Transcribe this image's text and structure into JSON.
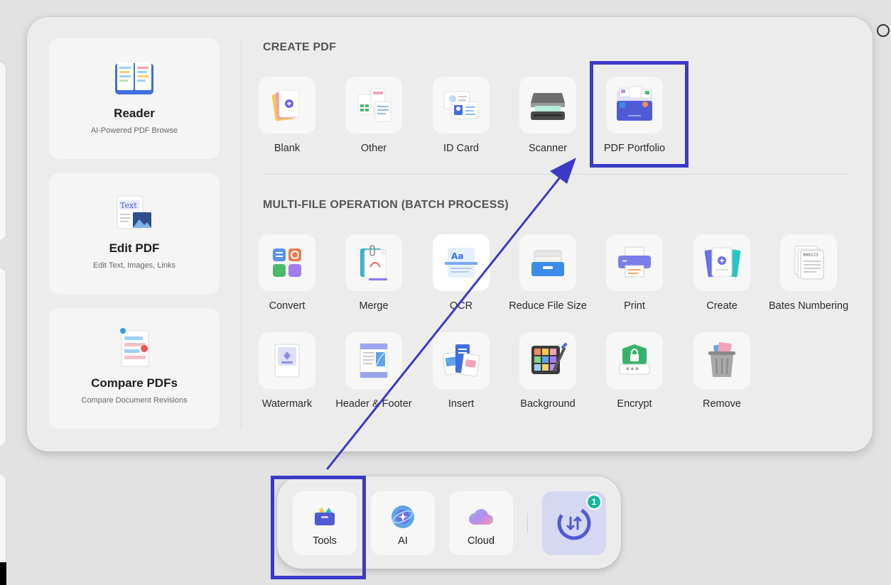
{
  "features": [
    {
      "title": "Reader",
      "subtitle": "AI-Powered PDF Browse",
      "icon": "book-icon"
    },
    {
      "title": "Edit PDF",
      "subtitle": "Edit Text, Images, Links",
      "icon": "edit-text-icon",
      "icon_text": "Text"
    },
    {
      "title": "Compare PDFs",
      "subtitle": "Compare Document Revisions",
      "icon": "compare-icon"
    }
  ],
  "create_section": {
    "title": "CREATE PDF",
    "tools": [
      {
        "label": "Blank",
        "icon": "blank-page-icon"
      },
      {
        "label": "Other",
        "icon": "other-files-icon"
      },
      {
        "label": "ID Card",
        "icon": "id-card-icon"
      },
      {
        "label": "Scanner",
        "icon": "scanner-icon"
      },
      {
        "label": "PDF Portfolio",
        "icon": "portfolio-icon"
      }
    ]
  },
  "batch_section": {
    "title": "MULTI-FILE OPERATION (BATCH PROCESS)",
    "tools": [
      {
        "label": "Convert",
        "icon": "convert-icon"
      },
      {
        "label": "Merge",
        "icon": "merge-icon"
      },
      {
        "label": "OCR",
        "icon": "ocr-icon",
        "icon_text": "Aa"
      },
      {
        "label": "Reduce File Size",
        "icon": "reduce-size-icon"
      },
      {
        "label": "Print",
        "icon": "print-icon"
      },
      {
        "label": "Create",
        "icon": "create-icon"
      },
      {
        "label": "Bates Numbering",
        "icon": "bates-icon",
        "icon_text": "000123"
      },
      {
        "label": "Watermark",
        "icon": "watermark-icon"
      },
      {
        "label": "Header & Footer",
        "icon": "header-footer-icon"
      },
      {
        "label": "Insert",
        "icon": "insert-icon"
      },
      {
        "label": "Background",
        "icon": "background-icon"
      },
      {
        "label": "Encrypt",
        "icon": "encrypt-icon",
        "icon_text": "***"
      },
      {
        "label": "Remove",
        "icon": "trash-icon"
      }
    ]
  },
  "dock": {
    "items": [
      {
        "label": "Tools",
        "icon": "toolbox-icon"
      },
      {
        "label": "AI",
        "icon": "ai-icon"
      },
      {
        "label": "Cloud",
        "icon": "cloud-icon"
      }
    ],
    "sync_badge": "1",
    "sync_icon": "sync-icon"
  },
  "colors": {
    "annotation": "#3a3ac7",
    "accent": "#4f5bd5",
    "badge": "#17b89b",
    "panel": "#ececec"
  }
}
